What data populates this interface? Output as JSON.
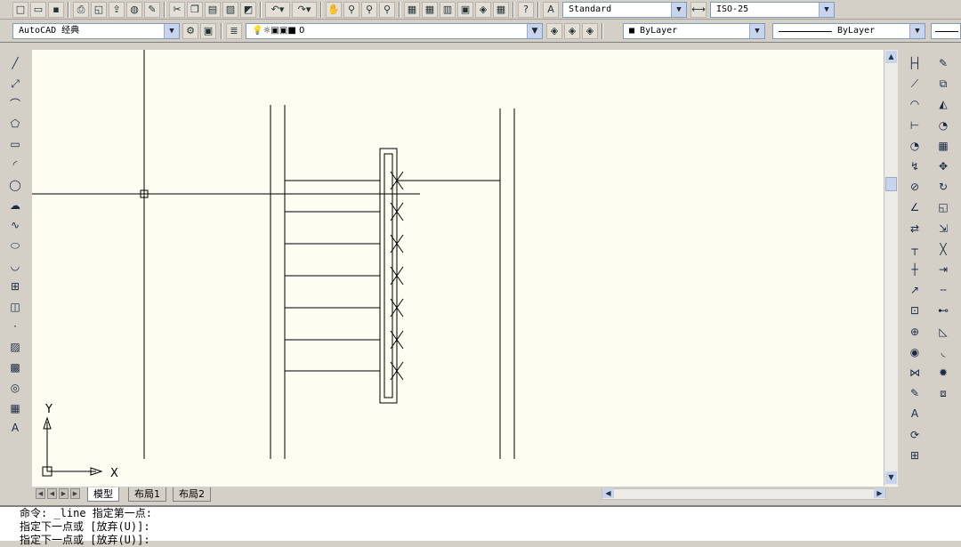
{
  "toolbar": {
    "text_style": "Standard",
    "dim_style": "ISO-25",
    "workspace": "AutoCAD 经典",
    "layer": "0",
    "color": "ByLayer",
    "linetype": "ByLayer"
  },
  "icons_left": [
    "line-icon",
    "construction-line-icon",
    "polyline-icon",
    "polygon-icon",
    "rectangle-icon",
    "arc-icon",
    "circle-icon",
    "revision-cloud-icon",
    "spline-icon",
    "ellipse-icon",
    "ellipse-arc-icon",
    "insert-block-icon",
    "make-block-icon",
    "point-icon",
    "hatch-icon",
    "gradient-icon",
    "region-icon",
    "table-icon",
    "multiline-text-icon"
  ],
  "icons_right1": [
    "linear-dim-icon",
    "aligned-dim-icon",
    "arc-length-icon",
    "ordinate-dim-icon",
    "radius-dim-icon",
    "jogged-dim-icon",
    "diameter-dim-icon",
    "angular-dim-icon",
    "quick-dim-icon",
    "baseline-dim-icon",
    "continue-dim-icon",
    "quick-leader-icon",
    "tolerance-icon",
    "center-mark-icon",
    "dim-inspect-icon",
    "jogged-linear-icon",
    "dim-edit-icon",
    "dim-text-edit-icon",
    "dim-update-icon",
    "dim-style-icon"
  ],
  "icons_right2": [
    "erase-icon",
    "copy-icon",
    "mirror-icon",
    "offset-icon",
    "array-icon",
    "move-icon",
    "rotate-icon",
    "scale-icon",
    "stretch-icon",
    "trim-icon",
    "extend-icon",
    "break-icon",
    "join-icon",
    "chamfer-icon",
    "fillet-icon",
    "explode-icon",
    "draworder-icon"
  ],
  "ucs": {
    "x_label": "X",
    "y_label": "Y"
  },
  "tabs": [
    "模型",
    "布局1",
    "布局2"
  ],
  "command_lines": [
    "命令: _line 指定第一点:",
    "指定下一点或 [放弃(U)]:",
    "指定下一点或 [放弃(U)]:"
  ]
}
